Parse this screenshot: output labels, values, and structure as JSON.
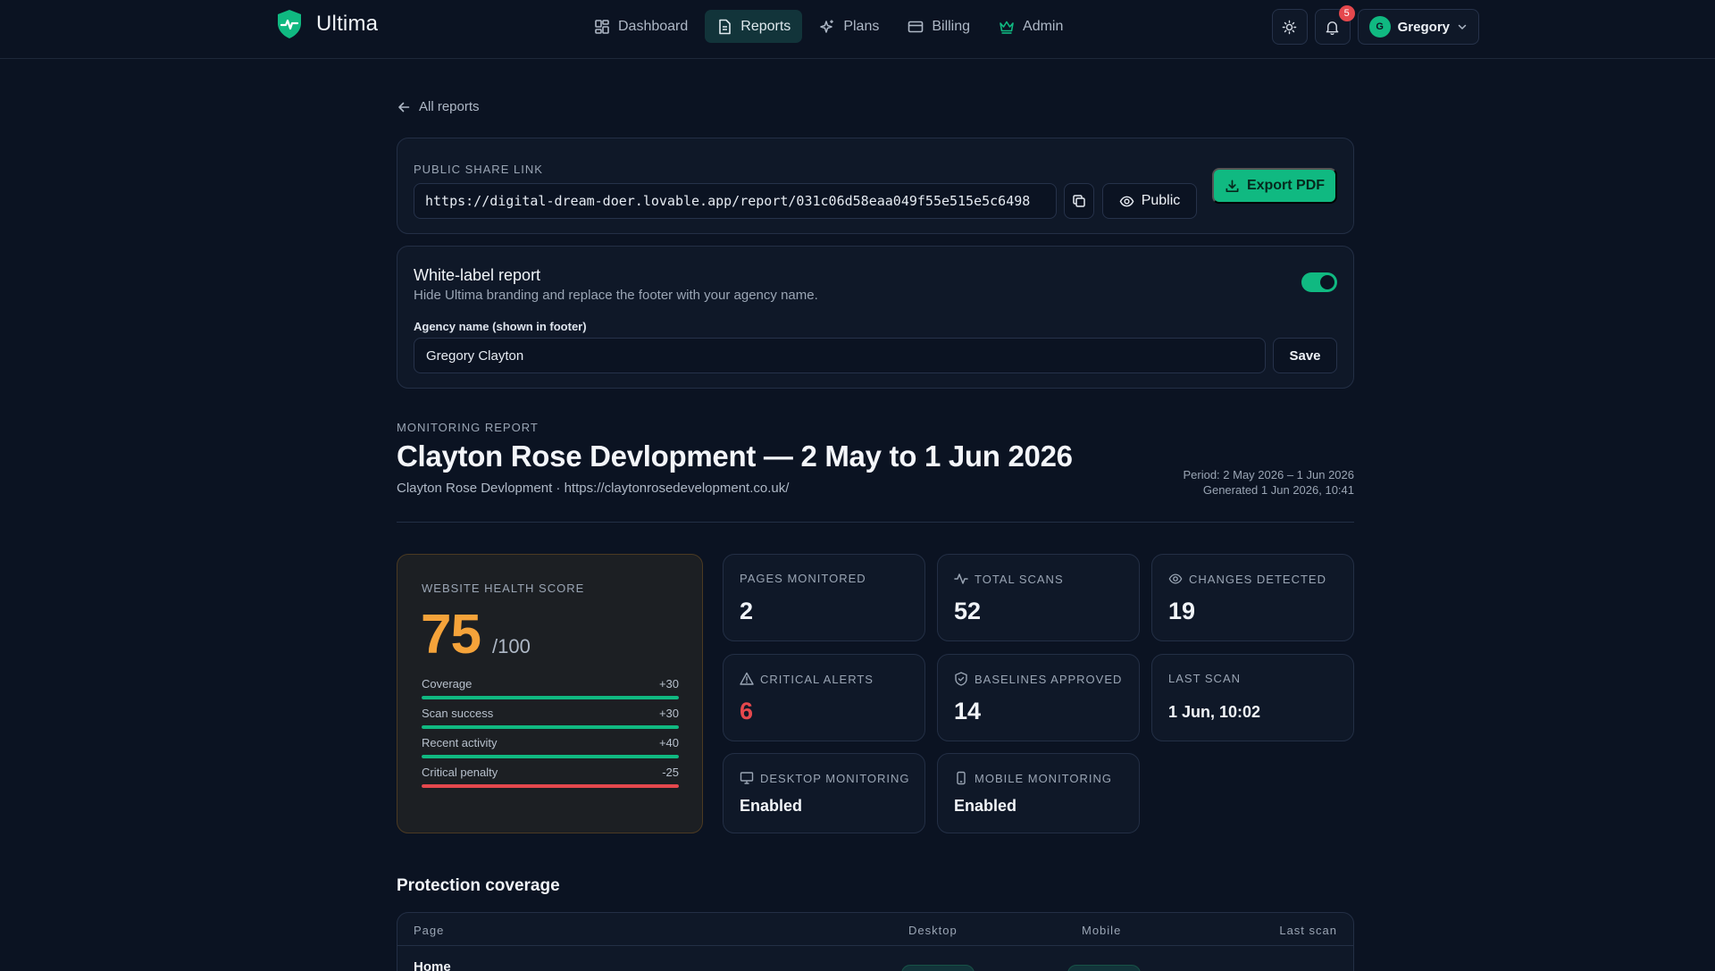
{
  "nav": {
    "brand": "Ultima",
    "links": [
      {
        "label": "Dashboard",
        "icon": "dashboard-icon"
      },
      {
        "label": "Reports",
        "icon": "file-icon"
      },
      {
        "label": "Plans",
        "icon": "sparkles-icon"
      },
      {
        "label": "Billing",
        "icon": "credit-card-icon"
      },
      {
        "label": "Admin",
        "icon": "crown-icon"
      }
    ],
    "active": "Reports",
    "notifications": "5",
    "user_initial": "G",
    "user_name": "Gregory"
  },
  "back_link": "All reports",
  "share": {
    "label": "Public share link",
    "url": "https://digital-dream-doer.lovable.app/report/031c06d58eaa049f55e515e5c6498",
    "visibility": "Public",
    "export_label": "Export PDF"
  },
  "white_label": {
    "title": "White-label report",
    "description": "Hide Ultima branding and replace the footer with your agency name.",
    "enabled": true,
    "agency_label": "Agency name (shown in footer)",
    "agency_value": "Gregory Clayton",
    "save_label": "Save"
  },
  "report": {
    "kicker": "Monitoring report",
    "title": "Clayton Rose Devlopment — 2 May to 1 Jun 2026",
    "subtitle": "Clayton Rose Devlopment · https://claytonrosedevelopment.co.uk/",
    "period": "Period: 2 May 2026 – 1 Jun 2026",
    "generated": "Generated 1 Jun 2026, 10:41"
  },
  "health": {
    "label": "Website health score",
    "score": "75",
    "max": "/100",
    "factors": [
      {
        "name": "Coverage",
        "value": "+30",
        "fill": 1.0,
        "color": "#10b981"
      },
      {
        "name": "Scan success",
        "value": "+30",
        "fill": 1.0,
        "color": "#10b981"
      },
      {
        "name": "Recent activity",
        "value": "+40",
        "fill": 1.0,
        "color": "#10b981"
      },
      {
        "name": "Critical penalty",
        "value": "-25",
        "fill": 1.0,
        "color": "#e5484d"
      }
    ]
  },
  "stats": {
    "pages_monitored": {
      "label": "Pages monitored",
      "value": "2"
    },
    "total_scans": {
      "label": "Total scans",
      "value": "52"
    },
    "changes_detected": {
      "label": "Changes detected",
      "value": "19"
    },
    "critical_alerts": {
      "label": "Critical alerts",
      "value": "6"
    },
    "baselines_approved": {
      "label": "Baselines approved",
      "value": "14"
    },
    "last_scan": {
      "label": "Last scan",
      "value": "1 Jun, 10:02"
    },
    "desktop_monitoring": {
      "label": "Desktop monitoring",
      "value": "Enabled"
    },
    "mobile_monitoring": {
      "label": "Mobile monitoring",
      "value": "Enabled"
    }
  },
  "coverage": {
    "title": "Protection coverage",
    "headers": {
      "page": "Page",
      "desktop": "Desktop",
      "mobile": "Mobile",
      "last_scan": "Last scan"
    },
    "rows": [
      {
        "page": "Home"
      }
    ]
  }
}
